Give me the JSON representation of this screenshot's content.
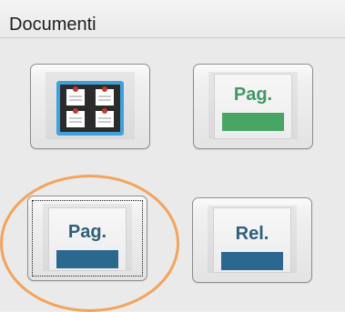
{
  "header": {
    "title": "Documenti"
  },
  "buttons": [
    {
      "id": "board",
      "icon": "bulletin-board-icon"
    },
    {
      "id": "pag-green",
      "label": "Pag.",
      "label_color": "#3f9a62",
      "bar_color": "#47a565"
    },
    {
      "id": "pag-blue",
      "label": "Pag.",
      "label_color": "#2f5f7d",
      "bar_color": "#2b6890",
      "focused": true,
      "highlighted": true
    },
    {
      "id": "rel-blue",
      "label": "Rel.",
      "label_color": "#2f5f7d",
      "bar_color": "#2b6890"
    }
  ],
  "colors": {
    "highlight_ring": "#f3a35c",
    "board_frame": "#2b2b2b",
    "board_border": "#3fa1dc",
    "pin": "#c43b2e"
  }
}
